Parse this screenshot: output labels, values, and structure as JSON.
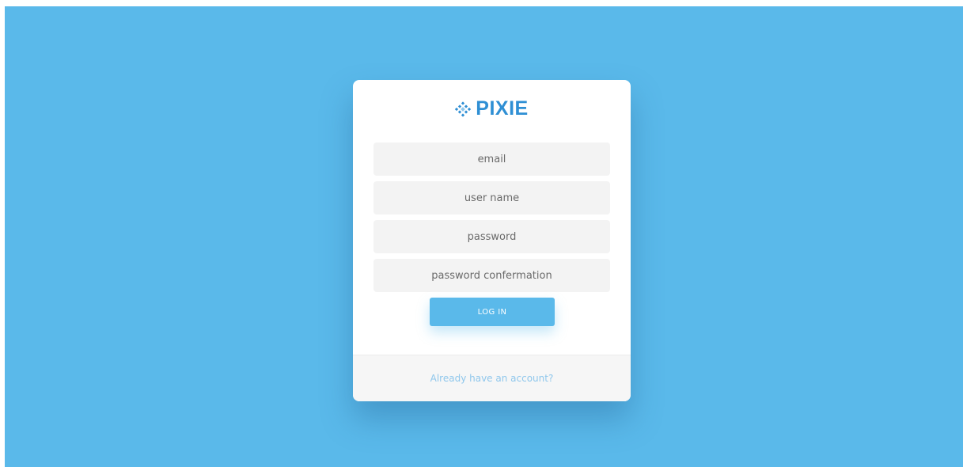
{
  "colors": {
    "background": "#5ab9ea",
    "brand": "#2f8fd4",
    "button": "#5ab9ea",
    "link": "#8fc7ec",
    "field": "#f3f3f3"
  },
  "brand": {
    "name": "PIXIE",
    "icon": "diamond-grid-logo-icon"
  },
  "form": {
    "email_placeholder": "email",
    "username_placeholder": "user name",
    "password_placeholder": "password",
    "password_confirm_placeholder": "password confermation",
    "submit_label": "LOG IN"
  },
  "footer": {
    "account_link": "Already have an account?"
  }
}
